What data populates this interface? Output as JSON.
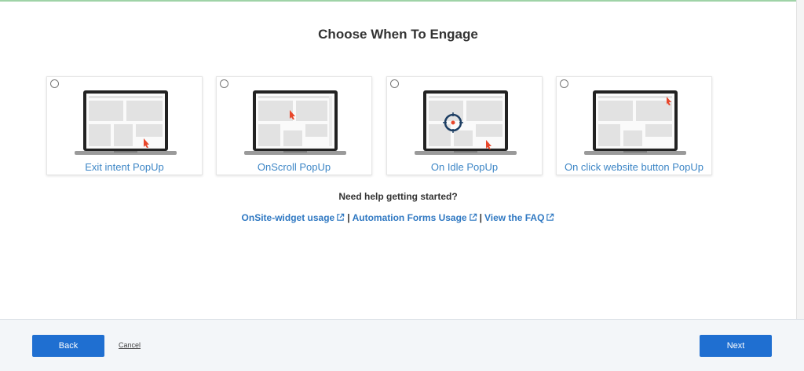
{
  "title": "Choose When To Engage",
  "cards": [
    {
      "label": "Exit intent PopUp"
    },
    {
      "label": "OnScroll PopUp"
    },
    {
      "label": "On Idle PopUp"
    },
    {
      "label": "On click website button PopUp"
    }
  ],
  "help": {
    "heading": "Need help getting started?",
    "links": [
      "OnSite-widget usage",
      "Automation Forms Usage",
      "View the FAQ"
    ],
    "separator": "|"
  },
  "footer": {
    "back_label": "Back",
    "cancel_label": "Cancel",
    "next_label": "Next"
  },
  "colors": {
    "accent": "#1f6fd1",
    "link": "#2f78c2",
    "cursor": "#e8472b"
  }
}
